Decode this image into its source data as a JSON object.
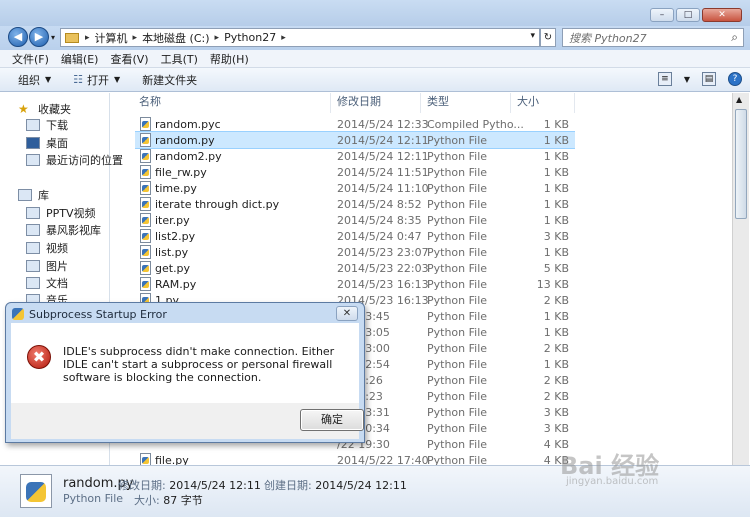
{
  "address": {
    "crumbs": [
      "计算机",
      "本地磁盘 (C:)",
      "Python27"
    ],
    "search_placeholder": "搜索 Python27"
  },
  "menu": [
    "文件(F)",
    "编辑(E)",
    "查看(V)",
    "工具(T)",
    "帮助(H)"
  ],
  "toolbar": {
    "organize": "组织",
    "open": "打开",
    "new_folder": "新建文件夹"
  },
  "nav": {
    "favorites": "收藏夹",
    "fav_items": [
      "下载",
      "桌面",
      "最近访问的位置"
    ],
    "libraries": "库",
    "lib_items": [
      "PPTV视频",
      "暴风影视库",
      "视频",
      "图片",
      "文档",
      "音乐"
    ],
    "network": "网络"
  },
  "columns": {
    "name": "名称",
    "date": "修改日期",
    "type": "类型",
    "size": "大小"
  },
  "files": [
    {
      "name": "random.pyc",
      "date": "2014/5/24 12:33",
      "type": "Compiled Pytho...",
      "size": "1 KB"
    },
    {
      "name": "random.py",
      "date": "2014/5/24 12:11",
      "type": "Python File",
      "size": "1 KB"
    },
    {
      "name": "random2.py",
      "date": "2014/5/24 12:11",
      "type": "Python File",
      "size": "1 KB"
    },
    {
      "name": "file_rw.py",
      "date": "2014/5/24 11:51",
      "type": "Python File",
      "size": "1 KB"
    },
    {
      "name": "time.py",
      "date": "2014/5/24 11:10",
      "type": "Python File",
      "size": "1 KB"
    },
    {
      "name": "iterate through dict.py",
      "date": "2014/5/24 8:52",
      "type": "Python File",
      "size": "1 KB"
    },
    {
      "name": "iter.py",
      "date": "2014/5/24 8:35",
      "type": "Python File",
      "size": "1 KB"
    },
    {
      "name": "list2.py",
      "date": "2014/5/24 0:47",
      "type": "Python File",
      "size": "3 KB"
    },
    {
      "name": "list.py",
      "date": "2014/5/23 23:07",
      "type": "Python File",
      "size": "1 KB"
    },
    {
      "name": "get.py",
      "date": "2014/5/23 22:03",
      "type": "Python File",
      "size": "5 KB"
    },
    {
      "name": "RAM.py",
      "date": "2014/5/23 16:13",
      "type": "Python File",
      "size": "13 KB"
    },
    {
      "name": "1.py",
      "date": "2014/5/23 16:13",
      "type": "Python File",
      "size": "2 KB"
    },
    {
      "name": "",
      "date": "/23 13:45",
      "type": "Python File",
      "size": "1 KB"
    },
    {
      "name": "",
      "date": "/23 13:05",
      "type": "Python File",
      "size": "1 KB"
    },
    {
      "name": "",
      "date": "/23 13:00",
      "type": "Python File",
      "size": "2 KB"
    },
    {
      "name": "",
      "date": "/23 12:54",
      "type": "Python File",
      "size": "1 KB"
    },
    {
      "name": "",
      "date": "/23 2:26",
      "type": "Python File",
      "size": "2 KB"
    },
    {
      "name": "",
      "date": "/23 0:23",
      "type": "Python File",
      "size": "2 KB"
    },
    {
      "name": "",
      "date": "/22 23:31",
      "type": "Python File",
      "size": "3 KB"
    },
    {
      "name": "",
      "date": "/22 20:34",
      "type": "Python File",
      "size": "3 KB"
    },
    {
      "name": "",
      "date": "/22 19:30",
      "type": "Python File",
      "size": "4 KB"
    },
    {
      "name": "file.py",
      "date": "2014/5/22 17:40",
      "type": "Python File",
      "size": "4 KB"
    }
  ],
  "status": {
    "filename": "random.py",
    "filetype": "Python File",
    "modified_label": "修改日期:",
    "modified": "2014/5/24 12:11",
    "created_label": "创建日期:",
    "created": "2014/5/24 12:11",
    "size_label": "大小:",
    "size": "87 字节"
  },
  "dialog": {
    "title": "Subprocess Startup Error",
    "message": "IDLE's subprocess didn't make connection.  Either IDLE can't start a subprocess or personal firewall software is blocking the connection.",
    "ok": "确定"
  },
  "watermark": {
    "line1": "Bai 经验",
    "line2": "jingyan.baidu.com"
  }
}
